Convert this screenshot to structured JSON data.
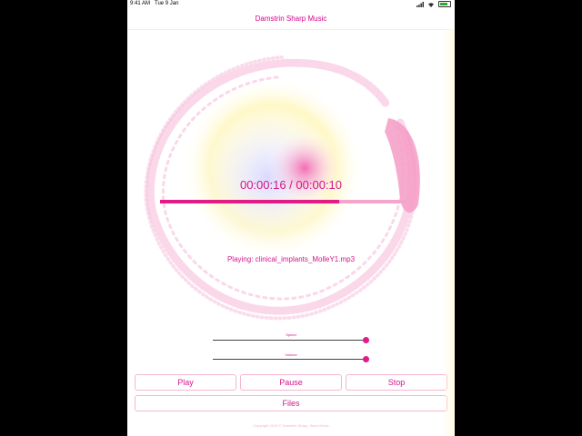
{
  "status_bar": {
    "time": "9:41 AM",
    "date": "Tue 9 Jan"
  },
  "app": {
    "title": "Damstrin Sharp Music"
  },
  "player": {
    "time_display": "00:00:16 / 00:00:10",
    "progress": 0.73,
    "now_playing": "Playing: clinical_implants_MolleY1.mp3"
  },
  "controls": {
    "speed": {
      "label": "Speed",
      "value": 1.0
    },
    "volume": {
      "label": "Volume",
      "value": 1.0
    }
  },
  "buttons": {
    "play": "Play",
    "pause": "Pause",
    "stop": "Stop",
    "files": "Files"
  },
  "footer": {
    "copyright": "Copyright 2018 © Damstrin Sharp, Wear Music"
  },
  "colors": {
    "accent": "#e21b87",
    "text": "#d3158c",
    "border": "#f4b6d3"
  }
}
